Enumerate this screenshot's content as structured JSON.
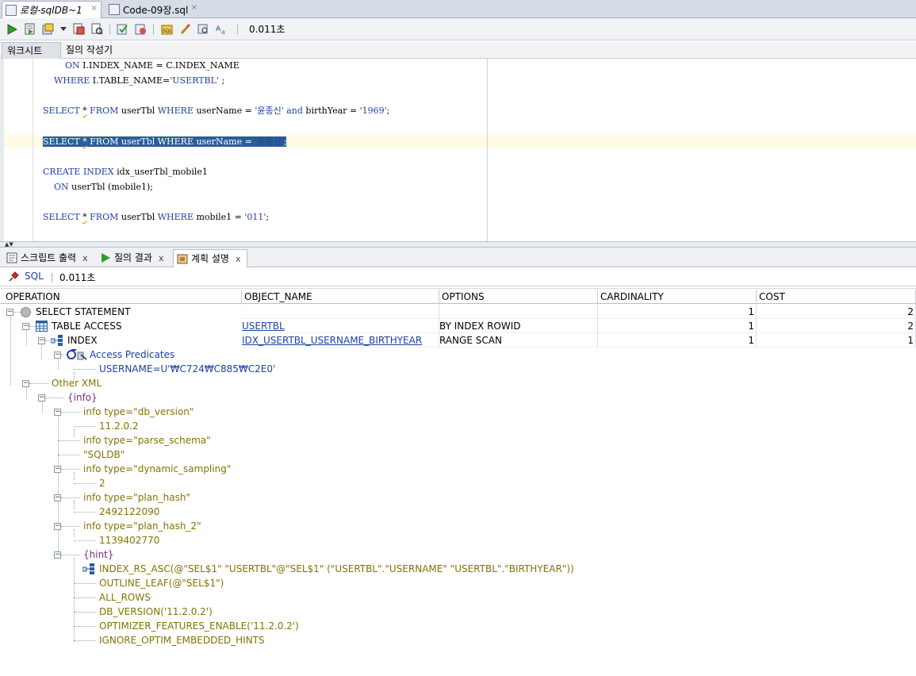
{
  "doc_tabs": [
    {
      "label": "로컬-sqlDB~1",
      "icon": "sql-worksheet-icon",
      "close": "×"
    },
    {
      "label": "Code-09장.sql",
      "icon": "sql-file-icon",
      "close": "×"
    }
  ],
  "toolbar": {
    "elapsed": "0.011초",
    "buttons": [
      "run-statement-icon",
      "run-script-icon",
      "autotrace-icon",
      "explain-plan-icon",
      "sql-tuning-icon",
      "commit-icon",
      "rollback-icon",
      "sql-history-icon",
      "clear-icon",
      "find-icon",
      "format-icon"
    ]
  },
  "worksheet_tabs": [
    {
      "label": "워크시트"
    },
    {
      "label": "질의 작성기"
    }
  ],
  "editor": {
    "lines": [
      {
        "indent": "        ",
        "parts": [
          [
            "kw",
            "ON"
          ],
          [
            "t",
            " I.INDEX_NAME = C.INDEX_NAME"
          ]
        ]
      },
      {
        "indent": "    ",
        "parts": [
          [
            "kw",
            "WHERE"
          ],
          [
            "t",
            " I.TABLE_NAME="
          ],
          [
            "str",
            "'USERTBL'"
          ],
          [
            "t",
            " ;"
          ]
        ]
      },
      {
        "indent": "",
        "parts": []
      },
      {
        "indent": "",
        "parts": [
          [
            "kw",
            "SELECT"
          ],
          [
            "t",
            " "
          ],
          [
            "sq",
            "*"
          ],
          [
            "t",
            " "
          ],
          [
            "kw",
            "FROM"
          ],
          [
            "t",
            " userTbl "
          ],
          [
            "kw",
            "WHERE"
          ],
          [
            "t",
            " userName = "
          ],
          [
            "str",
            "'윤종신'"
          ],
          [
            "t",
            " "
          ],
          [
            "kw",
            "and"
          ],
          [
            "t",
            " birthYear = "
          ],
          [
            "str",
            "'1969'"
          ],
          [
            "t",
            ";"
          ]
        ]
      },
      {
        "indent": "",
        "parts": []
      },
      {
        "indent": "",
        "selected": true,
        "parts": [
          [
            "kw",
            "SELECT"
          ],
          [
            "t",
            " "
          ],
          [
            "sq",
            "*"
          ],
          [
            "t",
            " "
          ],
          [
            "kw",
            "FROM"
          ],
          [
            "t",
            " userTbl "
          ],
          [
            "kw",
            "WHERE"
          ],
          [
            "t",
            " userName = "
          ],
          [
            "str",
            "'윤종신'"
          ],
          [
            "t",
            ";"
          ]
        ]
      },
      {
        "indent": "",
        "parts": []
      },
      {
        "indent": "",
        "parts": [
          [
            "kw",
            "CREATE"
          ],
          [
            "t",
            " "
          ],
          [
            "kw",
            "INDEX"
          ],
          [
            "t",
            " idx_userTbl_mobile1"
          ]
        ]
      },
      {
        "indent": "    ",
        "parts": [
          [
            "kw",
            "ON"
          ],
          [
            "t",
            " userTbl (mobile1);"
          ]
        ]
      },
      {
        "indent": "",
        "parts": []
      },
      {
        "indent": "",
        "parts": [
          [
            "kw",
            "SELECT"
          ],
          [
            "t",
            " "
          ],
          [
            "sq",
            "*"
          ],
          [
            "t",
            " "
          ],
          [
            "kw",
            "FROM"
          ],
          [
            "t",
            " userTbl "
          ],
          [
            "kw",
            "WHERE"
          ],
          [
            "t",
            " mobile1 = "
          ],
          [
            "str",
            "'011'"
          ],
          [
            "t",
            ";"
          ]
        ]
      }
    ]
  },
  "output_tabs": [
    {
      "label": "스크립트 출력",
      "close": "x",
      "icon": "script-output-icon"
    },
    {
      "label": "질의 결과",
      "close": "x",
      "icon": "query-result-icon"
    },
    {
      "label": "계획 설명",
      "close": "x",
      "icon": "explain-plan-icon"
    }
  ],
  "plan": {
    "sql_label": "SQL",
    "elapsed": "0.011초",
    "columns": [
      "OPERATION",
      "OBJECT_NAME",
      "OPTIONS",
      "CARDINALITY",
      "COST"
    ],
    "rows": [
      {
        "operation": "SELECT STATEMENT",
        "object": "",
        "options": "",
        "cardinality": "1",
        "cost": "2"
      },
      {
        "operation": "TABLE ACCESS",
        "object": "USERTBL",
        "options": "BY INDEX ROWID",
        "cardinality": "1",
        "cost": "2"
      },
      {
        "operation": "INDEX",
        "object": "IDX_USERTBL_USERNAME_BIRTHYEAR",
        "options": "RANGE SCAN",
        "cardinality": "1",
        "cost": "1"
      }
    ],
    "access_predicates_label": "Access Predicates",
    "access_predicate": "USERNAME=U'₩C724₩C885₩C2E0'",
    "other_xml_label": "Other XML",
    "info_label": "{info}",
    "info_items": [
      {
        "key": "info type=\"db_version\"",
        "value": "11.2.0.2"
      },
      {
        "key": "info type=\"parse_schema\"",
        "value": "\"SQLDB\""
      },
      {
        "key": "info type=\"dynamic_sampling\"",
        "value": "2"
      },
      {
        "key": "info type=\"plan_hash\"",
        "value": "2492122090"
      },
      {
        "key": "info type=\"plan_hash_2\"",
        "value": "1139402770"
      }
    ],
    "hint_label": "{hint}",
    "hints": [
      "INDEX_RS_ASC(@\"SEL$1\" \"USERTBL\"@\"SEL$1\" (\"USERTBL\".\"USERNAME\" \"USERTBL\".\"BIRTHYEAR\"))",
      "OUTLINE_LEAF(@\"SEL$1\")",
      "ALL_ROWS",
      "DB_VERSION('11.2.0.2')",
      "OPTIMIZER_FEATURES_ENABLE('11.2.0.2')",
      "IGNORE_OPTIM_EMBEDDED_HINTS"
    ]
  }
}
